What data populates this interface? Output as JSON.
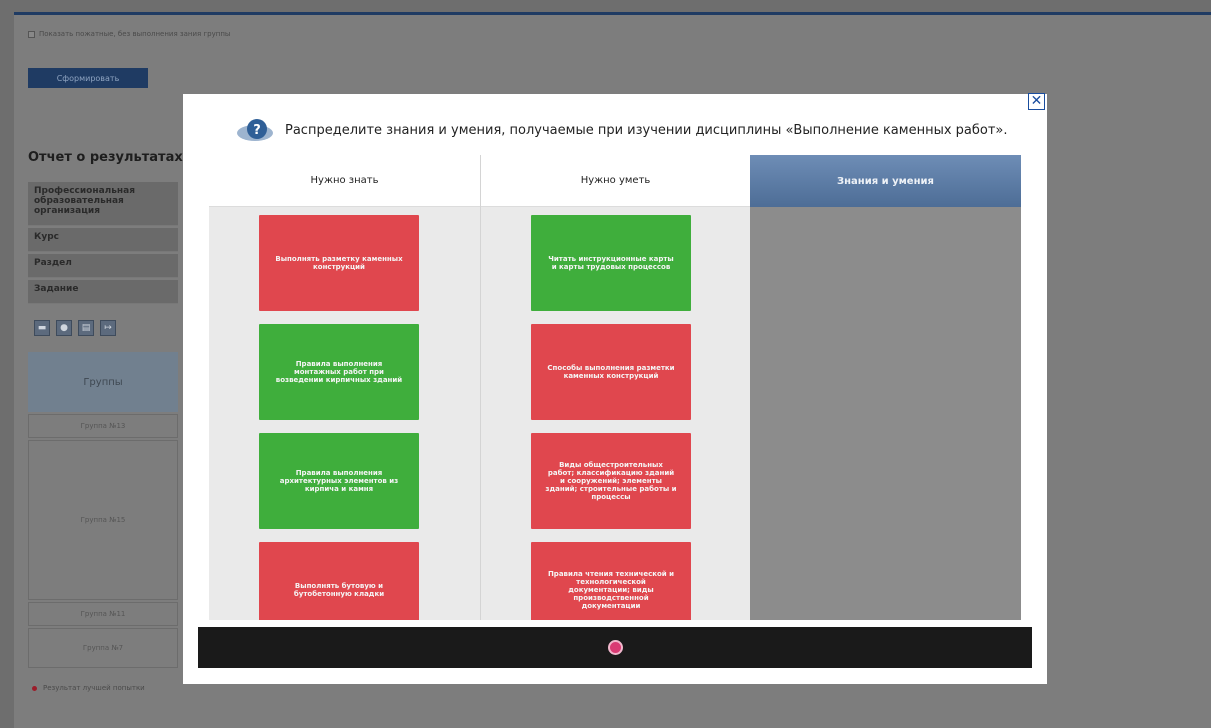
{
  "background": {
    "show_empty_groups_label": "Показать пожатные, без выполнения зания группы",
    "generate_button": "Сформировать",
    "report_title": "Отчет о результатах р",
    "filters": [
      {
        "label": "Профессиональная образовательная организация"
      },
      {
        "label": "Курс"
      },
      {
        "label": "Раздел"
      },
      {
        "label": "Задание"
      }
    ],
    "groups_header": "Группы",
    "group_rows": [
      "Группа №13",
      "Группа №15",
      "Группа №11",
      "Группа №7"
    ],
    "legend": "Результат лучшей попытки"
  },
  "modal": {
    "question": "Распределите знания и умения, получаемые при изучении дисциплины «Выполнение каменных работ».",
    "columns": [
      {
        "title": "Нужно знать"
      },
      {
        "title": "Нужно уметь"
      },
      {
        "title": "Знания и умения"
      }
    ],
    "column1_cards": [
      {
        "text": "Выполнять разметку каменных конструкций",
        "color": "red"
      },
      {
        "text": "Правила выполнения монтажных работ при возведении кирпичных зданий",
        "color": "green"
      },
      {
        "text": "Правила выполнения архитектурных элементов из кирпича и камня",
        "color": "green"
      },
      {
        "text": "Выполнять бутовую и бутобетонную кладки",
        "color": "red"
      }
    ],
    "column2_cards": [
      {
        "text": "Читать инструкционные карты и карты трудовых процессов",
        "color": "green"
      },
      {
        "text": "Способы выполнения разметки каменных конструкций",
        "color": "red"
      },
      {
        "text": "Виды общестроительных работ; классификацию зданий и сооружений; элементы зданий; строительные работы и процессы",
        "color": "red"
      },
      {
        "text": "Правила чтения технической и технологической документации; виды производственной документации",
        "color": "red"
      }
    ],
    "colors": {
      "red": "#e0474e",
      "green": "#3fae3c",
      "header_blue": "#5a7aa4",
      "page_dot": "#d93a73"
    }
  }
}
